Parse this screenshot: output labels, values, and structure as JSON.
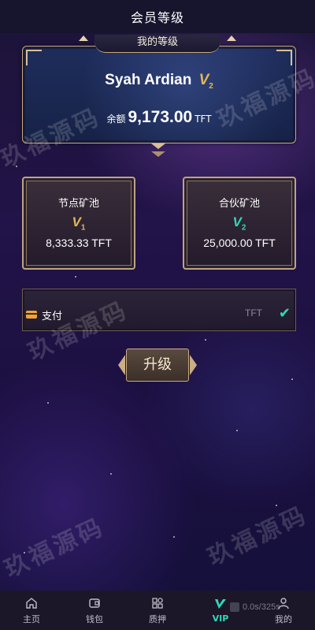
{
  "header": {
    "title": "会员等级"
  },
  "level_card": {
    "tab_label": "我的等级",
    "user_name": "Syah Ardian",
    "level_badge": "V",
    "level_number": "2",
    "balance_label": "余额",
    "balance_value": "9,173.00",
    "balance_unit": "TFT"
  },
  "pools": [
    {
      "name": "节点矿池",
      "badge": "V",
      "level": "1",
      "value": "8,333.33 TFT",
      "color": "#e0b85a"
    },
    {
      "name": "合伙矿池",
      "badge": "V",
      "level": "2",
      "value": "25,000.00 TFT",
      "color": "#2fd9b8"
    }
  ],
  "payment": {
    "label": "支付",
    "unit": "TFT",
    "icon": "card-icon",
    "check_icon": "check-icon"
  },
  "upgrade": {
    "label": "升级"
  },
  "watermark": "玖福源码",
  "tabbar": {
    "items": [
      {
        "label": "主页",
        "icon": "home-icon"
      },
      {
        "label": "钱包",
        "icon": "wallet-icon"
      },
      {
        "label": "质押",
        "icon": "grid-icon"
      },
      {
        "label": "VIP",
        "icon": "vip-icon",
        "active": true
      },
      {
        "label": "我的",
        "icon": "user-icon"
      }
    ]
  },
  "timer": "0.0s/325s",
  "colors": {
    "accent": "#2fd9b8",
    "gold": "#c9ad84",
    "badge_gold": "#e0b85a"
  }
}
